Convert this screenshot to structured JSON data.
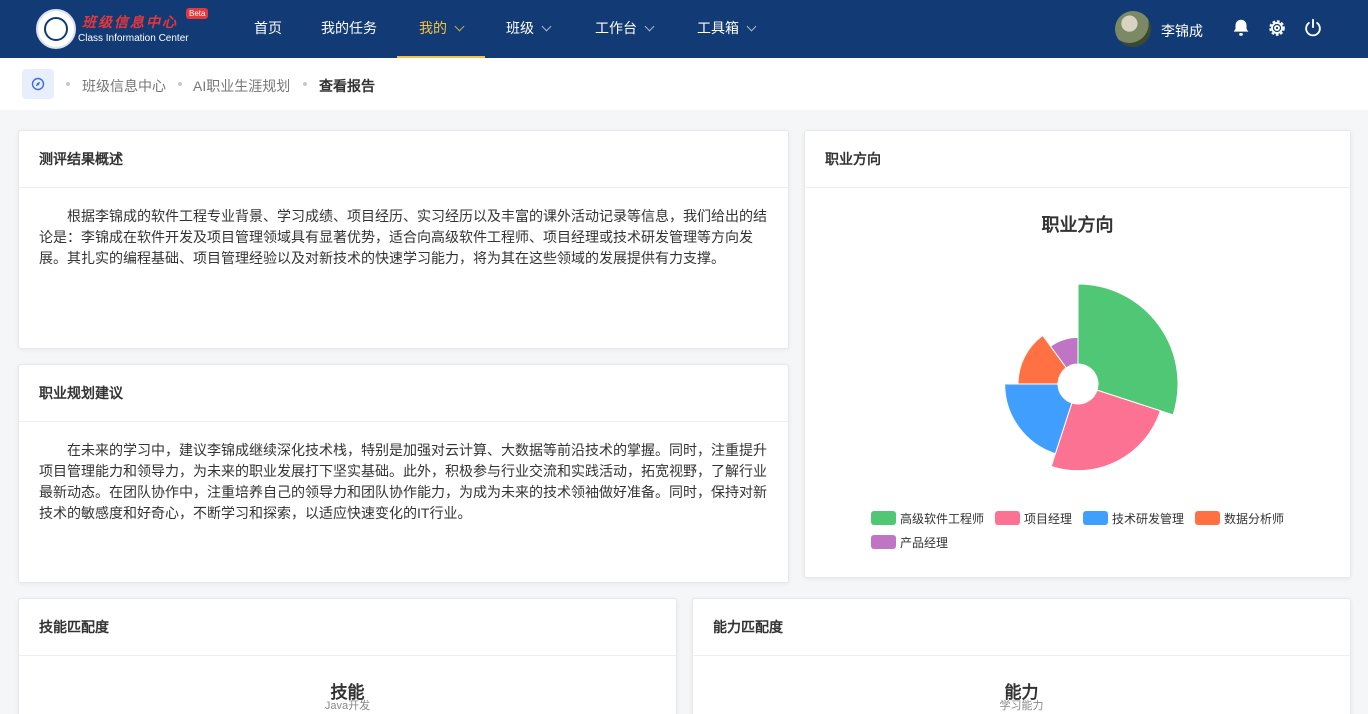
{
  "header": {
    "logo_title": "班级信息中心",
    "logo_subtitle": "Class Information Center",
    "logo_badge": "Beta",
    "nav": [
      {
        "label": "首页"
      },
      {
        "label": "我的任务"
      },
      {
        "label": "我的"
      },
      {
        "label": "班级"
      },
      {
        "label": "工作台"
      },
      {
        "label": "工具箱"
      }
    ],
    "username": "李锦成"
  },
  "breadcrumb": {
    "items": [
      "班级信息中心",
      "AI职业生涯规划",
      "查看报告"
    ]
  },
  "summary_card": {
    "title": "测评结果概述",
    "text": "根据李锦成的软件工程专业背景、学习成绩、项目经历、实习经历以及丰富的课外活动记录等信息，我们给出的结论是：李锦成在软件开发及项目管理领域具有显著优势，适合向高级软件工程师、项目经理或技术研发管理等方向发展。其扎实的编程基础、项目管理经验以及对新技术的快速学习能力，将为其在这些领域的发展提供有力支撑。"
  },
  "advice_card": {
    "title": "职业规划建议",
    "text": "在未来的学习中，建议李锦成继续深化技术栈，特别是加强对云计算、大数据等前沿技术的掌握。同时，注重提升项目管理能力和领导力，为未来的职业发展打下坚实基础。此外，积极参与行业交流和实践活动，拓宽视野，了解行业最新动态。在团队协作中，注重培养自己的领导力和团队协作能力，为成为未来的技术领袖做好准备。同时，保持对新技术的敏感度和好奇心，不断学习和探索，以适应快速变化的IT行业。"
  },
  "career_card": {
    "title": "职业方向"
  },
  "skills_card": {
    "title": "技能匹配度",
    "chart_title": "技能",
    "chart_subtitle": "Java开发"
  },
  "ability_card": {
    "title": "能力匹配度",
    "chart_title": "能力",
    "chart_subtitle": "学习能力"
  },
  "chart_data": {
    "type": "pie",
    "variant": "nightingale-rose",
    "title": "职业方向",
    "categories": [
      "高级软件工程师",
      "项目经理",
      "技术研发管理",
      "数据分析师",
      "产品经理"
    ],
    "values": [
      30,
      25,
      20,
      15,
      10
    ],
    "colors": [
      "#4fc775",
      "#fb7293",
      "#409eff",
      "#ff7043",
      "#c075c4"
    ],
    "legend_position": "bottom"
  },
  "icons": {
    "bell": "bell-icon",
    "settings": "gear-icon",
    "power": "power-icon",
    "compass": "compass-icon"
  }
}
